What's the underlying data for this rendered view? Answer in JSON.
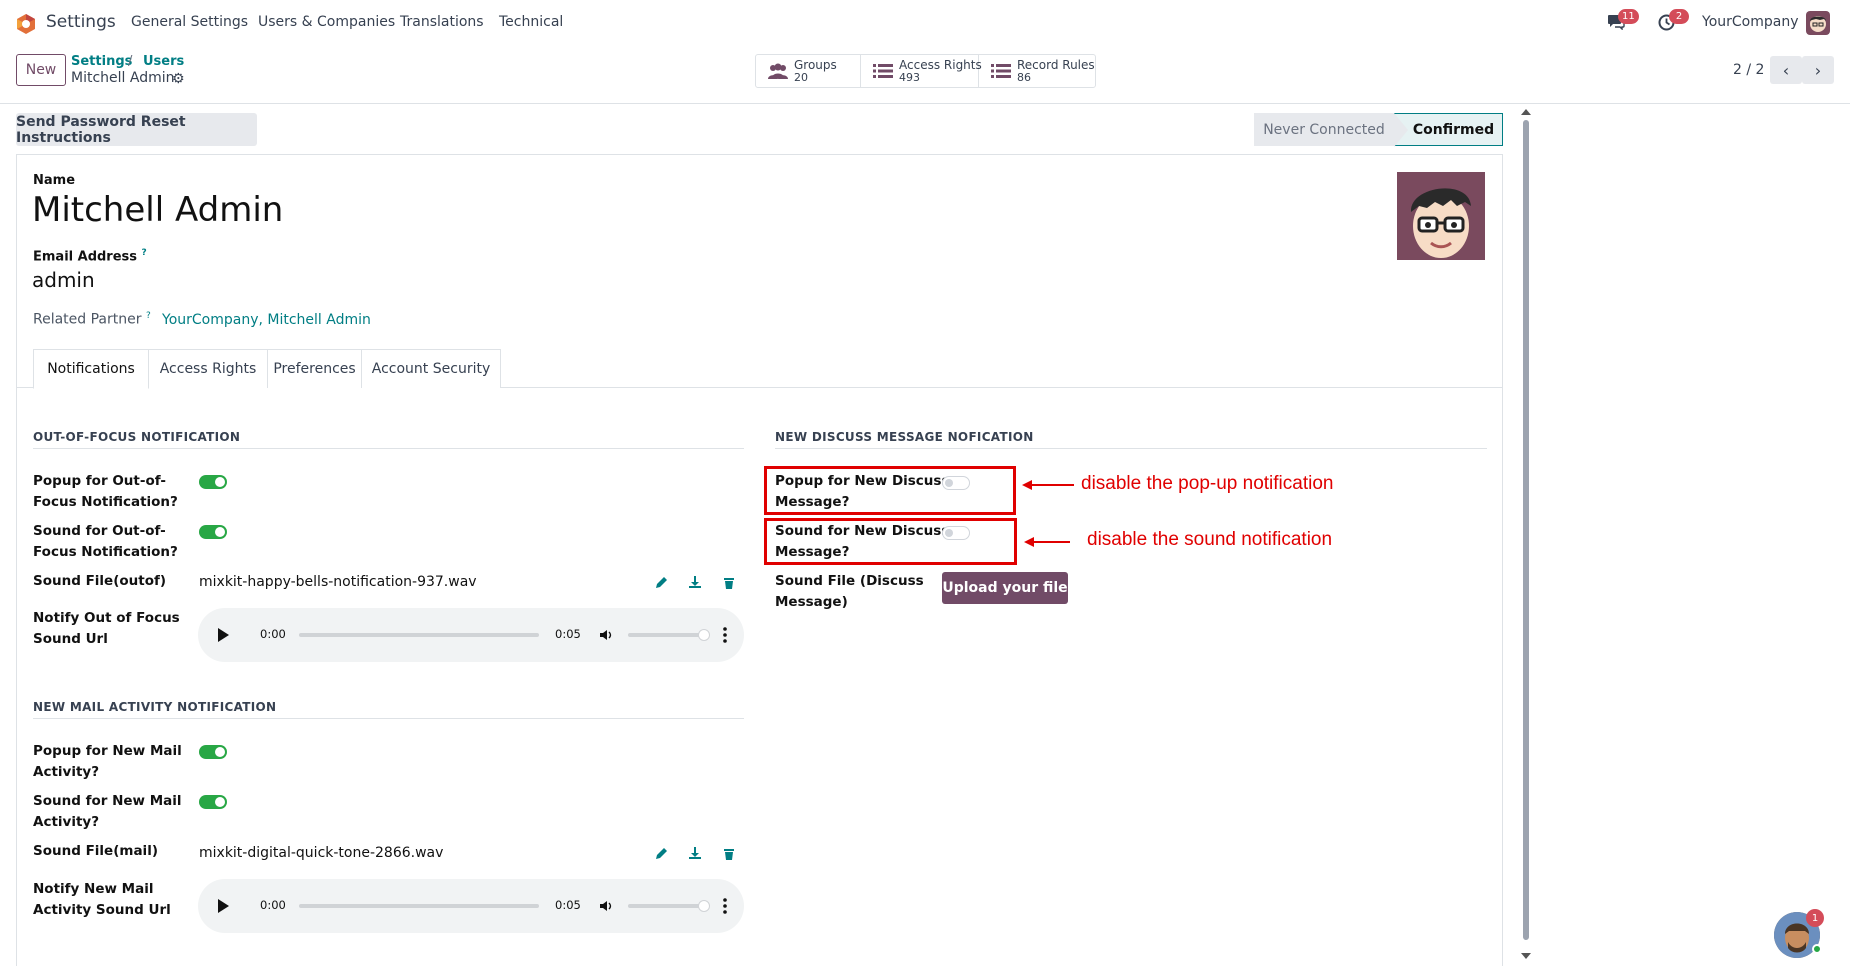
{
  "topnav": {
    "app_title": "Settings",
    "menu": [
      "General Settings",
      "Users & Companies",
      "Translations",
      "Technical"
    ],
    "messages_badge": "11",
    "activities_badge": "2",
    "company": "YourCompany"
  },
  "control_panel": {
    "new_label": "New",
    "breadcrumb": [
      "Settings",
      "Users"
    ],
    "breadcrumb_sep": "/",
    "record_name": "Mitchell Admin",
    "stats": [
      {
        "label": "Groups",
        "value": "20",
        "icon": "groups-icon"
      },
      {
        "label": "Access Rights",
        "value": "493",
        "icon": "list-icon"
      },
      {
        "label": "Record Rules",
        "value": "86",
        "icon": "list-icon"
      }
    ],
    "pager": "2 / 2"
  },
  "status": {
    "reset_button": "Send Password Reset Instructions",
    "states": [
      "Never Connected",
      "Confirmed"
    ],
    "active_state": "Confirmed"
  },
  "form": {
    "name_label": "Name",
    "name_value": "Mitchell Admin",
    "email_label": "Email Address",
    "email_value": "admin",
    "help_mark": "?",
    "partner_label": "Related Partner",
    "partner_value": "YourCompany, Mitchell Admin"
  },
  "tabs": [
    "Notifications",
    "Access Rights",
    "Preferences",
    "Account Security"
  ],
  "out_of_focus": {
    "title": "OUT-OF-FOCUS NOTIFICATION",
    "popup_label_1": "Popup for Out-of-",
    "popup_label_2": "Focus Notification?",
    "popup_enabled": true,
    "sound_label_1": "Sound for Out-of-",
    "sound_label_2": "Focus Notification?",
    "sound_enabled": true,
    "file_label": "Sound File(outof)",
    "file_value": "mixkit-happy-bells-notification-937.wav",
    "url_label_1": "Notify Out of Focus",
    "url_label_2": "Sound Url",
    "audio_current": "0:00",
    "audio_duration": "0:05"
  },
  "mail_activity": {
    "title": "NEW MAIL ACTIVITY NOTIFICATION",
    "popup_label_1": "Popup for New Mail",
    "popup_label_2": "Activity?",
    "popup_enabled": true,
    "sound_label_1": "Sound for New Mail",
    "sound_label_2": "Activity?",
    "sound_enabled": true,
    "file_label": "Sound File(mail)",
    "file_value": "mixkit-digital-quick-tone-2866.wav",
    "url_label_1": "Notify New Mail",
    "url_label_2": "Activity Sound Url",
    "audio_current": "0:00",
    "audio_duration": "0:05"
  },
  "discuss": {
    "title": "NEW DISCUSS MESSAGE NOFICATION",
    "popup_label_1": "Popup for New Discuss",
    "popup_label_2": "Message?",
    "popup_enabled": false,
    "sound_label_1": "Sound for New Discuss",
    "sound_label_2": "Message?",
    "sound_enabled": false,
    "file_label_1": "Sound File (Discuss",
    "file_label_2": "Message)",
    "upload_label": "Upload your file"
  },
  "annotations": {
    "popup_note": "disable the pop-up notification",
    "sound_note": "disable the sound notification",
    "color": "#e00000"
  },
  "chat_badge": "1",
  "colors": {
    "primary": "#714b67",
    "link": "#017e84",
    "toggle_on": "#28a745",
    "badge": "#d44c59"
  }
}
